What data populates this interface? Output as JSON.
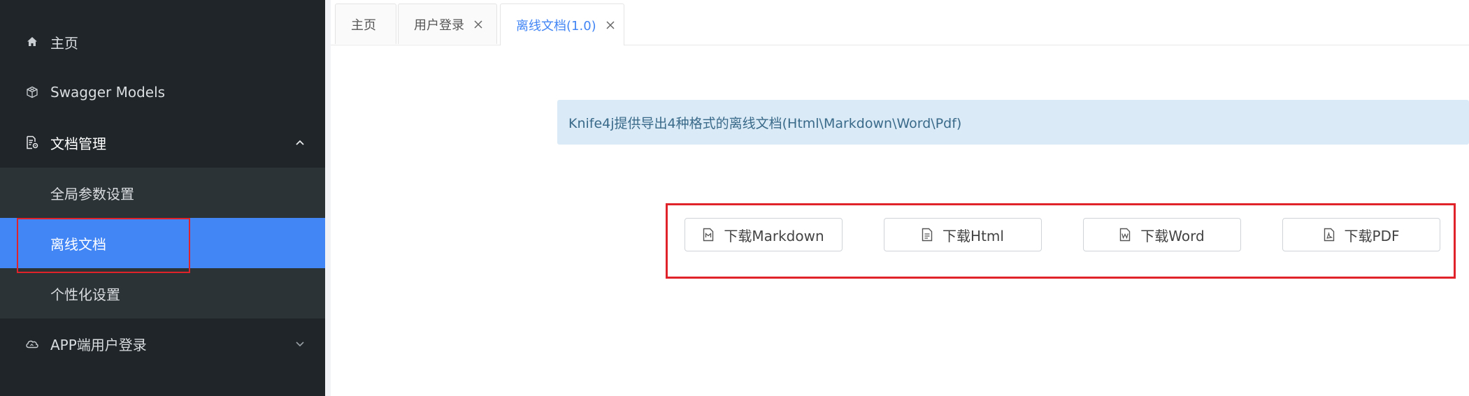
{
  "sidebar": {
    "items": [
      {
        "label": "主页",
        "icon": "home-icon"
      },
      {
        "label": "Swagger Models",
        "icon": "cube-icon"
      },
      {
        "label": "文档管理",
        "icon": "document-settings-icon",
        "expanded": true
      },
      {
        "label": "APP端用户登录",
        "icon": "cloud-icon",
        "expanded": false
      }
    ],
    "submenu": [
      {
        "label": "全局参数设置",
        "active": false
      },
      {
        "label": "离线文档",
        "active": true
      },
      {
        "label": "个性化设置",
        "active": false
      }
    ]
  },
  "tabs": [
    {
      "label": "主页",
      "closable": false,
      "active": false
    },
    {
      "label": "用户登录",
      "closable": true,
      "active": false
    },
    {
      "label": "离线文档(1.0)",
      "closable": true,
      "active": true
    }
  ],
  "banner": {
    "text": "Knife4j提供导出4种格式的离线文档(Html\\Markdown\\Word\\Pdf)"
  },
  "downloads": [
    {
      "label": "下载Markdown",
      "icon": "markdown-file-icon"
    },
    {
      "label": "下载Html",
      "icon": "html-file-icon"
    },
    {
      "label": "下载Word",
      "icon": "word-file-icon"
    },
    {
      "label": "下载PDF",
      "icon": "pdf-file-icon"
    }
  ],
  "colors": {
    "sidebar_bg": "#1f2528",
    "submenu_bg": "#2c3337",
    "accent": "#4285f4",
    "highlight_box": "#e0222a",
    "banner_bg": "#daeaf6"
  }
}
